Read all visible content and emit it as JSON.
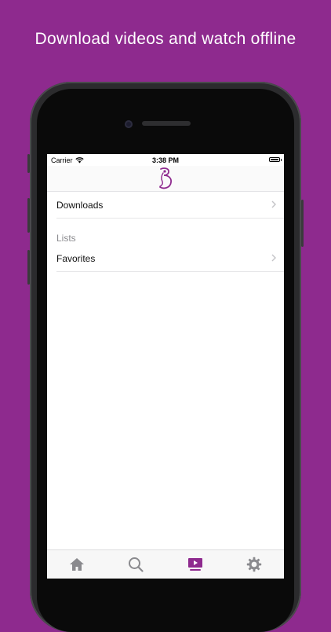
{
  "headline": "Download videos and watch offline",
  "status_bar": {
    "carrier": "Carrier",
    "time": "3:38 PM"
  },
  "nav": {
    "logo_icon": "b-silhouette-logo-icon"
  },
  "list": {
    "downloads_label": "Downloads",
    "section_header": "Lists",
    "favorites_label": "Favorites"
  },
  "tabs": [
    {
      "name": "home",
      "icon": "home-icon",
      "active": false
    },
    {
      "name": "search",
      "icon": "search-icon",
      "active": false
    },
    {
      "name": "videos",
      "icon": "play-screen-icon",
      "active": true
    },
    {
      "name": "settings",
      "icon": "gear-icon",
      "active": false
    }
  ],
  "colors": {
    "brand": "#8e2a8e",
    "tab_active": "#8e2a8e",
    "tab_inactive": "#8a8a8e"
  }
}
